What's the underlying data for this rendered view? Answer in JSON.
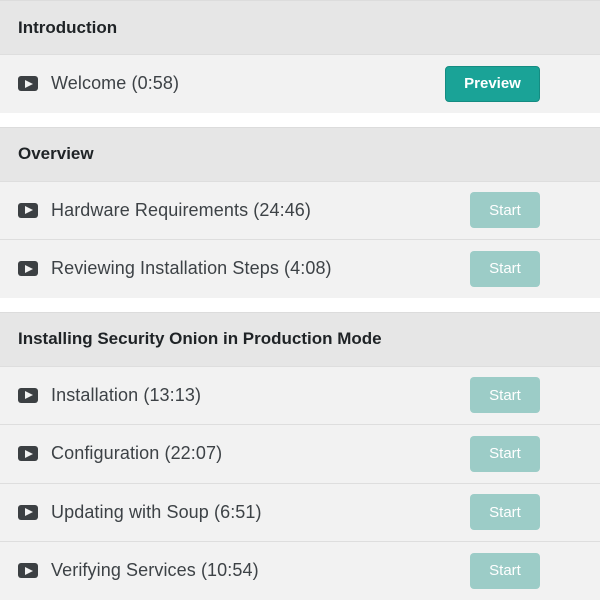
{
  "sections": [
    {
      "title": "Introduction",
      "lessons": [
        {
          "icon": "play-icon",
          "title": "Welcome (0:58)",
          "action": "Preview"
        }
      ]
    },
    {
      "title": "Overview",
      "lessons": [
        {
          "icon": "play-icon",
          "title": "Hardware Requirements (24:46)",
          "action": "Start"
        },
        {
          "icon": "play-icon",
          "title": "Reviewing Installation Steps (4:08)",
          "action": "Start"
        }
      ]
    },
    {
      "title": "Installing Security Onion in Production Mode",
      "lessons": [
        {
          "icon": "play-icon",
          "title": "Installation (13:13)",
          "action": "Start"
        },
        {
          "icon": "play-icon",
          "title": "Configuration (22:07)",
          "action": "Start"
        },
        {
          "icon": "play-icon",
          "title": "Updating with Soup (6:51)",
          "action": "Start"
        },
        {
          "icon": "play-icon",
          "title": "Verifying Services (10:54)",
          "action": "Start"
        }
      ]
    }
  ],
  "colors": {
    "preview_button": "#1aa397",
    "start_button": "#9cccc7",
    "header_bg": "#e6e6e6",
    "row_bg": "#f2f2f2"
  }
}
